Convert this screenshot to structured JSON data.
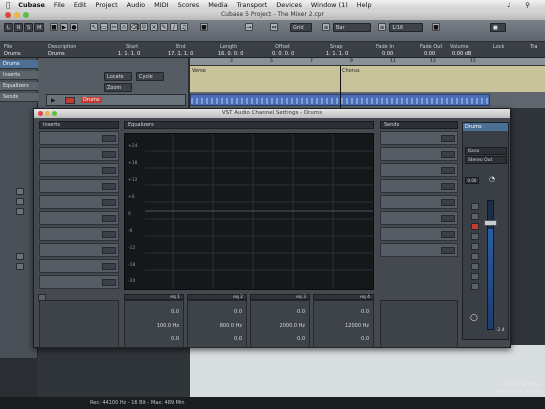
{
  "menubar": {
    "apple": "",
    "app": "Cubase",
    "items": [
      "File",
      "Edit",
      "Project",
      "Audio",
      "MIDI",
      "Scores",
      "Media",
      "Transport",
      "Devices",
      "Window (1)",
      "Help"
    ]
  },
  "window": {
    "title": "Cubase 5 Project - The Mixer 2.cpr"
  },
  "toolbar": {
    "buttons": [
      "L",
      "R",
      "S",
      "M"
    ],
    "snap": "Bar",
    "quantize": "1/16"
  },
  "infoline": {
    "labels": [
      "File",
      "Description",
      "Start",
      "End",
      "Length",
      "Offset",
      "Snap",
      "Fade In",
      "Fade Out",
      "Volume",
      "Lock",
      "Tra"
    ],
    "values": [
      "Drums",
      "Drums",
      "1. 1. 1. 0",
      "17. 1. 1. 0",
      "16. 0. 0. 0",
      "0. 0. 0. 0",
      "1. 1. 1. 0",
      "0.00",
      "0.00",
      "0.00 dB",
      "",
      ""
    ]
  },
  "inspector": {
    "rows": [
      "Drums",
      "Inserts",
      "Equalizers",
      "Sends"
    ]
  },
  "tracklist": {
    "track_name": "Drums",
    "fields": [
      "Locate",
      "Cycle",
      "Zoom"
    ]
  },
  "ruler": {
    "ticks": [
      "3",
      "5",
      "7",
      "9",
      "11",
      "13",
      "15"
    ]
  },
  "markers": [
    "Verse",
    "Chorus"
  ],
  "vst": {
    "title": "VST Audio Channel Settings - Drums",
    "inserts_label": "Inserts",
    "eq_label": "Equalizers",
    "sends_label": "Sends",
    "eq_axis": [
      "+24",
      "+18",
      "+12",
      "+6",
      "0",
      "-6",
      "-12",
      "-18",
      "-24"
    ],
    "eq_band_labels": [
      "eq 1",
      "eq 2",
      "eq 3",
      "eq 4"
    ],
    "eq_values": [
      [
        "0.0",
        "100.0 Hz",
        "0.0"
      ],
      [
        "0.0",
        "800.0 Hz",
        "0.0"
      ],
      [
        "0.0",
        "2000.0 Hz",
        "0.0"
      ],
      [
        "0.0",
        "12000 Hz",
        "0.0"
      ]
    ]
  },
  "strip": {
    "title": "Drums",
    "routing": [
      "Kano",
      "Stereo Out"
    ],
    "level": "0.00",
    "peak": "-2.4"
  },
  "statusbar": {
    "text": "Rec: 44100 Hz - 16 Bit - Max: 489 Min"
  },
  "watermark": {
    "line1": "©SFKVideo",
    "line2": "www.sfk.com"
  }
}
